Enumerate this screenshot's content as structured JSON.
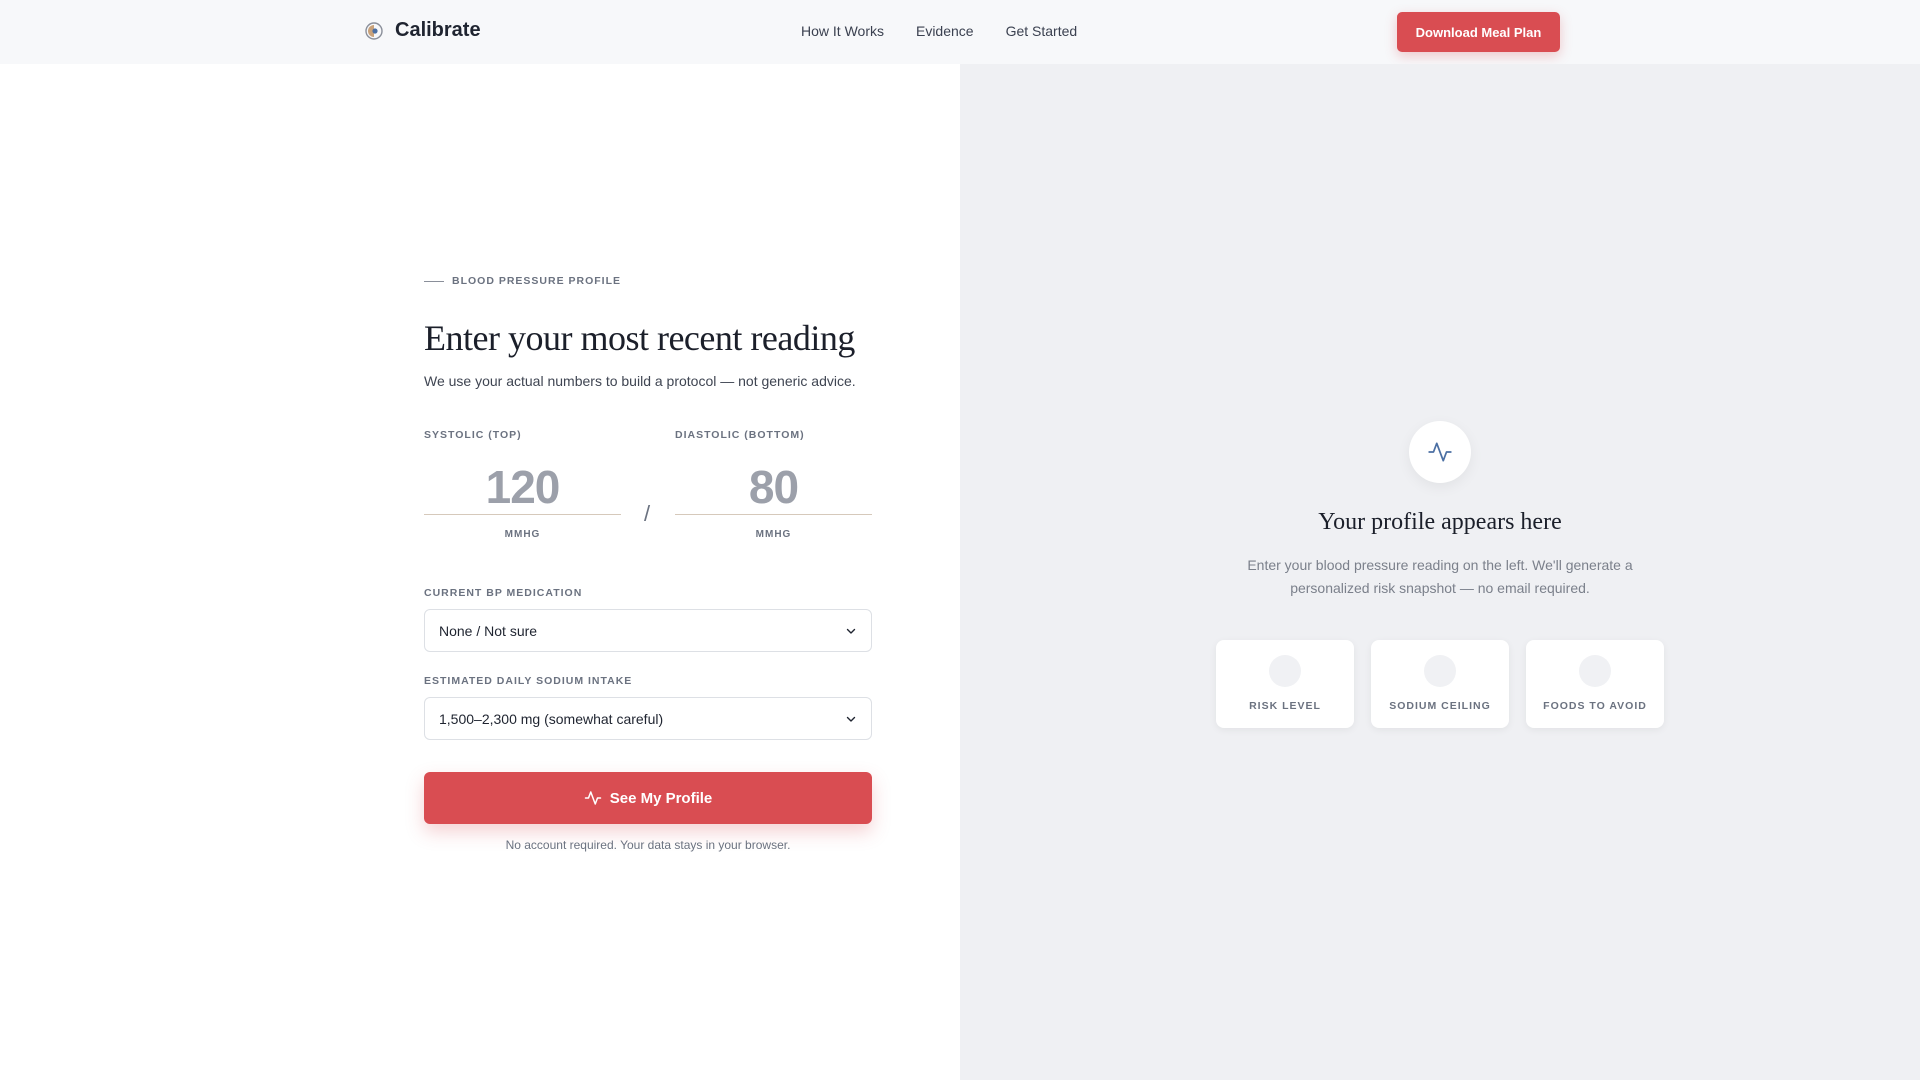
{
  "header": {
    "brand_name": "Calibrate",
    "logo_icon": "logo-icon",
    "nav": [
      "How It Works",
      "Evidence",
      "Get Started"
    ],
    "cta_label": "Download Meal Plan"
  },
  "form": {
    "eyebrow": "BLOOD PRESSURE PROFILE",
    "title": "Enter your most recent reading",
    "subtitle": "We use your actual numbers to build a protocol — not generic advice.",
    "systolic": {
      "label": "SYSTOLIC (TOP)",
      "placeholder": "120",
      "unit": "MMHG"
    },
    "separator": "/",
    "diastolic": {
      "label": "DIASTOLIC (BOTTOM)",
      "placeholder": "80",
      "unit": "MMHG"
    },
    "medication": {
      "label": "CURRENT BP MEDICATION",
      "value": "None / Not sure"
    },
    "sodium": {
      "label": "ESTIMATED DAILY SODIUM INTAKE",
      "value": "1,500–2,300 mg (somewhat careful)"
    },
    "submit_label": "See My Profile",
    "submit_icon": "pulse-icon",
    "fine_print": "No account required. Your data stays in your browser."
  },
  "preview": {
    "icon": "pulse-icon",
    "title": "Your profile appears here",
    "description": "Enter your blood pressure reading on the left. We'll generate a personalized risk snapshot — no email required.",
    "cards": [
      "RISK LEVEL",
      "SODIUM CEILING",
      "FOODS TO AVOID"
    ]
  },
  "colors": {
    "accent": "#d94d52",
    "right_pane_bg": "#eff0f3",
    "header_bg": "#f7f8fa"
  }
}
